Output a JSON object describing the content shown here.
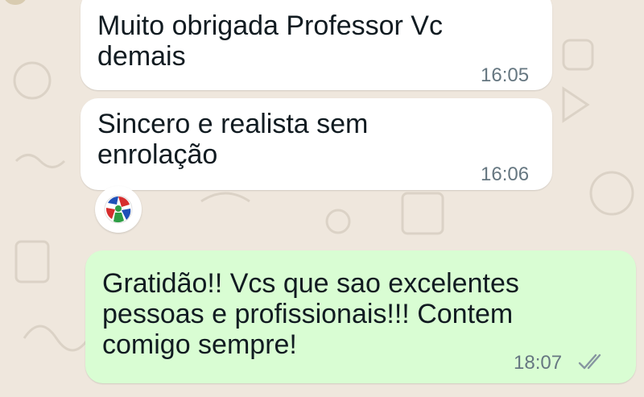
{
  "messages": [
    {
      "direction": "incoming",
      "text": "Muito obrigada  Professor  Vc demais",
      "time": "16:05"
    },
    {
      "direction": "incoming",
      "text": "Sincero e realista sem enrolação",
      "time": "16:06",
      "reaction": "colorful-ball-emoji-icon"
    },
    {
      "direction": "outgoing",
      "text": "Gratidão!! Vcs que sao excelentes pessoas e profissionais!!! Contem comigo sempre!",
      "time": "18:07",
      "status": "read-double-check-icon"
    }
  ],
  "colors": {
    "wallpaper": "#efe7dd",
    "incoming_bubble": "#ffffff",
    "outgoing_bubble": "#d9fdd3",
    "timestamp": "#667781"
  }
}
